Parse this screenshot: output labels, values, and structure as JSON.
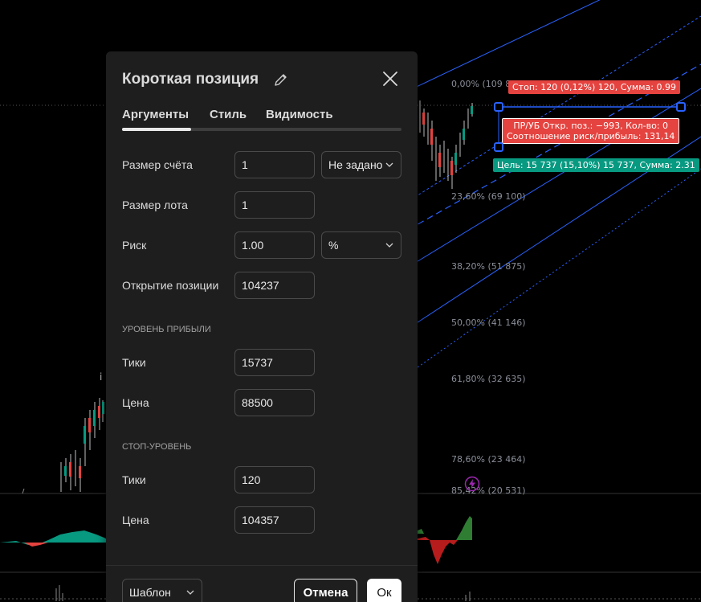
{
  "dialog": {
    "title": "Короткая позиция",
    "tabs": [
      {
        "label": "Аргументы",
        "active": true
      },
      {
        "label": "Стиль",
        "active": false
      },
      {
        "label": "Видимость",
        "active": false
      }
    ],
    "fields": {
      "account_size": {
        "label": "Размер счёта",
        "value": "1",
        "select": "Не задано"
      },
      "lot_size": {
        "label": "Размер лота",
        "value": "1"
      },
      "risk": {
        "label": "Риск",
        "value": "1.00",
        "select": "%"
      },
      "entry": {
        "label": "Открытие позиции",
        "value": "104237"
      }
    },
    "profit_level": {
      "section": "Уровень прибыли",
      "ticks_label": "Тики",
      "ticks": "15737",
      "price_label": "Цена",
      "price": "88500"
    },
    "stop_level": {
      "section": "Стоп-уровень",
      "ticks_label": "Тики",
      "ticks": "120",
      "price_label": "Цена",
      "price": "104357"
    },
    "footer": {
      "template": "Шаблон",
      "cancel": "Отмена",
      "ok": "Ок"
    }
  },
  "chart": {
    "tags": {
      "stop": "Стоп: 120 (0,12%) 120, Сумма: 0.99",
      "pnl_line1": "ПР/УБ Откр. поз.: −993, Кол-во: 0",
      "pnl_line2": "Соотношение риск/прибыль: 131,14",
      "target": "Цель: 15 737 (15,10%) 15 737, Сумма: 2.31"
    },
    "fib_levels": [
      "0,00% (109 83",
      "23,60% (69 100)",
      "38,20% (51 875)",
      "50,00% (41 146)",
      "61,80% (32 635)",
      "78,60% (23 464)",
      "85,42% (20 531)"
    ],
    "colors": {
      "stop": "#e5433f",
      "target": "#089981",
      "accent": "#2962ff",
      "bolt": "#9c27b0"
    }
  }
}
